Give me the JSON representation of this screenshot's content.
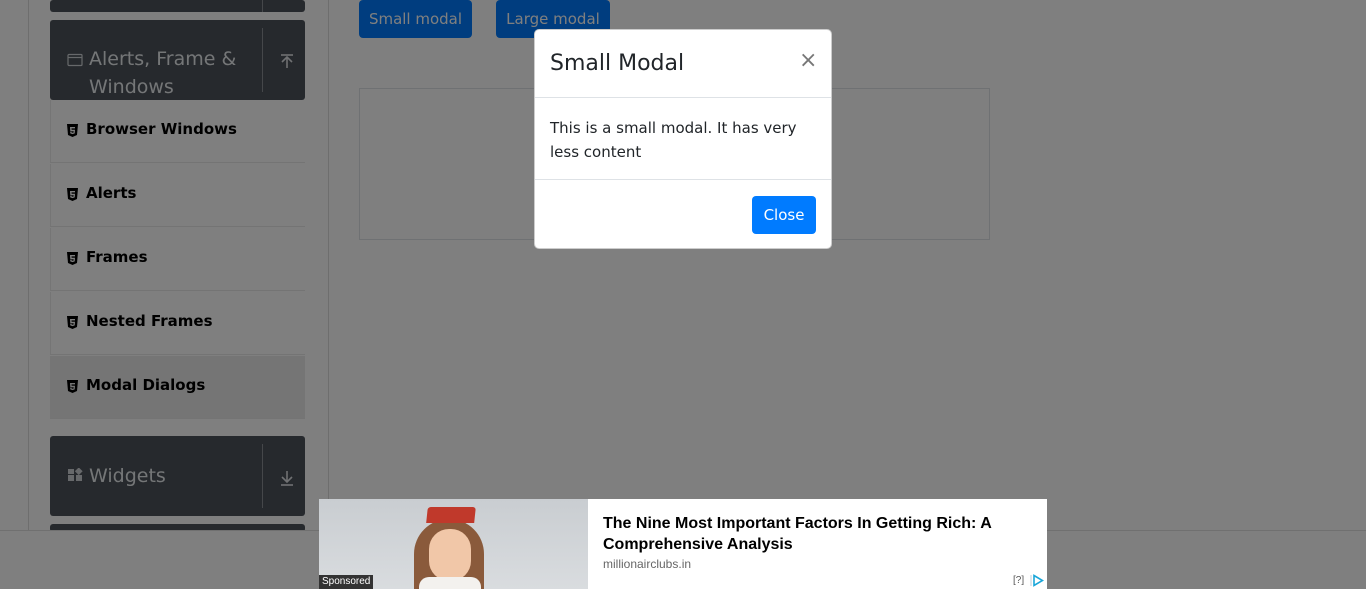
{
  "sidebar": {
    "alerts_group_label_line1": "Alerts, Frame &",
    "alerts_group_label_line2": "Windows",
    "items": [
      {
        "label": "Browser Windows"
      },
      {
        "label": "Alerts"
      },
      {
        "label": "Frames"
      },
      {
        "label": "Nested Frames"
      },
      {
        "label": "Modal Dialogs"
      }
    ],
    "widgets_group_label": "Widgets"
  },
  "main": {
    "small_modal_button": "Small modal",
    "large_modal_button": "Large modal"
  },
  "modal": {
    "title": "Small Modal",
    "close_symbol": "×",
    "body": "This is a small modal. It has very less content",
    "close_button": "Close"
  },
  "ad": {
    "sponsored": "Sponsored",
    "title": "The Nine Most Important Factors In Getting Rich: A Comprehensive Analysis",
    "domain": "millionairclubs.in",
    "help": "[?]"
  },
  "colors": {
    "primary": "#007bff",
    "sidebar_header": "#4d535b",
    "overlay": "rgba(0,0,0,0.5)"
  }
}
